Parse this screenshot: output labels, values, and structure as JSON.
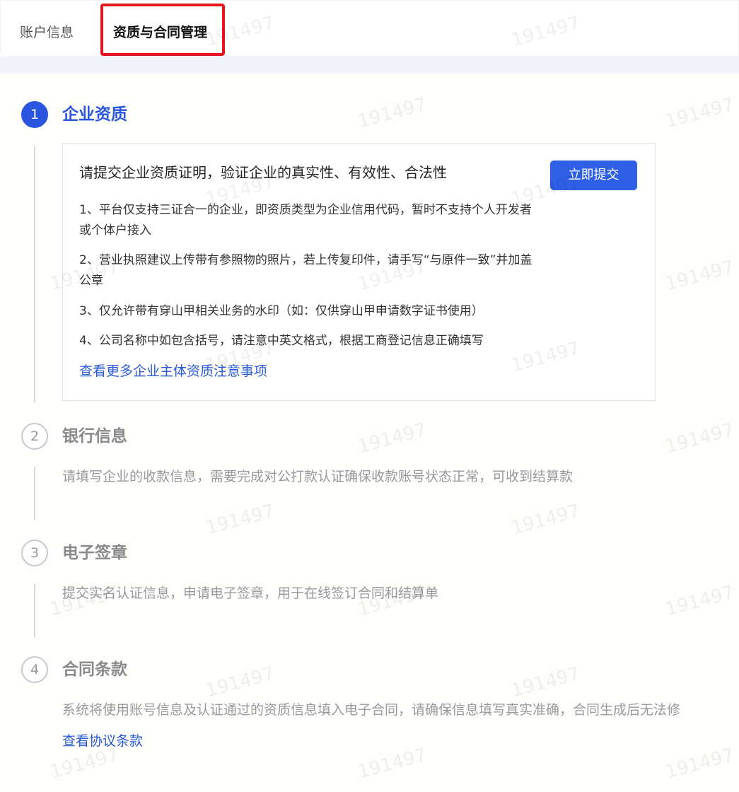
{
  "tabs": [
    {
      "label": "账户信息"
    },
    {
      "label": "资质与合同管理"
    }
  ],
  "watermark": "191497",
  "steps": [
    {
      "number": "1",
      "title": "企业资质"
    },
    {
      "number": "2",
      "title": "银行信息",
      "description": "请填写企业的收款信息，需要完成对公打款认证确保收款账号状态正常，可收到结算款"
    },
    {
      "number": "3",
      "title": "电子签章",
      "description": "提交实名认证信息，申请电子签章，用于在线签订合同和结算单"
    },
    {
      "number": "4",
      "title": "合同条款",
      "description": "系统将使用账号信息及认证通过的资质信息填入电子合同，请确保信息填写真实准确，合同生成后无法修",
      "link": "查看协议条款"
    }
  ],
  "qualification_card": {
    "title": "请提交企业资质证明，验证企业的真实性、有效性、合法性",
    "submit_label": "立即提交",
    "notes": [
      "1、平台仅支持三证合一的企业，即资质类型为企业信用代码，暂时不支持个人开发者或个体户接入",
      "2、营业执照建议上传带有参照物的照片，若上传复印件，请手写“与原件一致”并加盖公章",
      "3、仅允许带有穿山甲相关业务的水印（如：仅供穿山甲申请数字证书使用）",
      "4、公司名称中如包含括号，请注意中英文格式，根据工商登记信息正确填写"
    ],
    "more_link": "查看更多企业主体资质注意事项"
  },
  "colors": {
    "accent": "#2a56df",
    "highlight": "#e8141c",
    "link": "#2a5bd7"
  }
}
